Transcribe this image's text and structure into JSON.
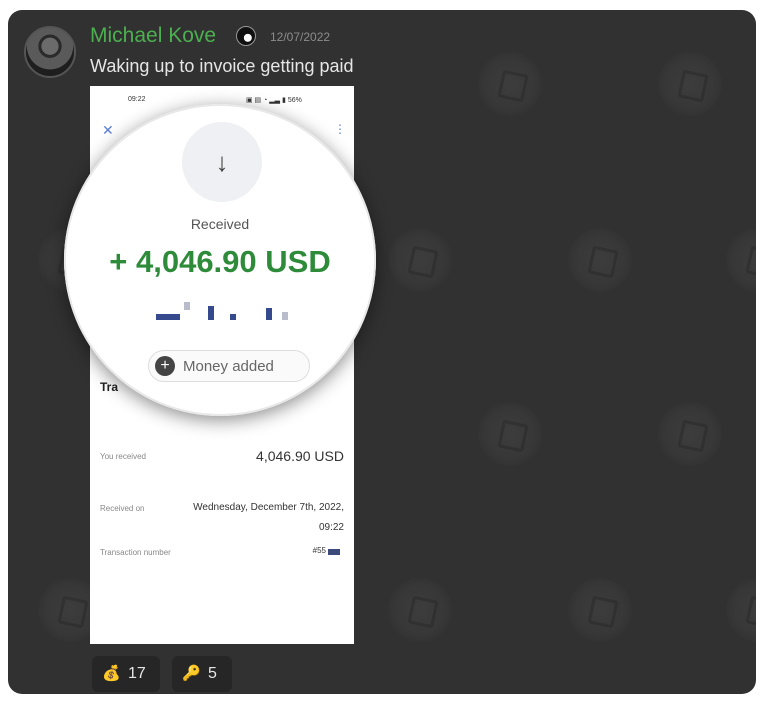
{
  "post": {
    "username": "Michael Kove",
    "timestamp": "12/07/2022",
    "message": "Waking up to invoice getting paid",
    "user_badge_icon": "eight-ball-icon",
    "username_color": "#4caf50"
  },
  "screenshot": {
    "status_time": "09:22",
    "status_battery": "56%",
    "received_label": "Received",
    "amount": "+ 4,046.90 USD",
    "amount_color": "#2e8b3a",
    "money_added_label": "Money added",
    "transaction_heading": "Tra",
    "rows": [
      {
        "label": "You received",
        "value": "4,046.90 USD"
      },
      {
        "label": "Received on",
        "value": "Wednesday, December 7th, 2022,",
        "value2": "09:22"
      },
      {
        "label": "Transaction number",
        "value": "#55"
      }
    ]
  },
  "reactions": [
    {
      "emoji": "💰",
      "icon": "money-bag-icon",
      "count": "17"
    },
    {
      "emoji": "🔑",
      "icon": "key-icon",
      "count": "5"
    }
  ]
}
